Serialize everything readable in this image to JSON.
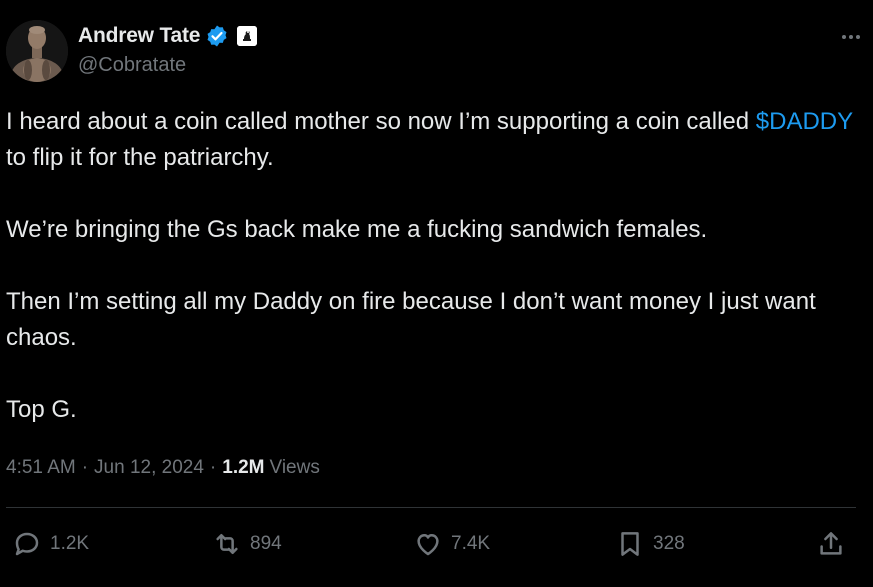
{
  "author": {
    "display_name": "Andrew Tate",
    "handle": "@Cobratate",
    "verified": true,
    "verified_color": "#1d9bf0"
  },
  "tweet": {
    "paragraphs": [
      {
        "pre": "I heard about a coin called mother so now I’m supporting a coin called",
        "cashtag": "$DADDY",
        "post": "to flip it for the patriarchy."
      },
      {
        "text": "We’re bringing the Gs back make me a fucking sandwich females."
      },
      {
        "text": "Then I’m setting all my Daddy on fire because I don’t want money I just want chaos."
      },
      {
        "text": "Top G."
      }
    ]
  },
  "meta": {
    "time": "4:51 AM",
    "separator": "·",
    "date": "Jun 12, 2024",
    "views_count": "1.2M",
    "views_label": "Views"
  },
  "actions": {
    "replies": "1.2K",
    "reposts": "894",
    "likes": "7.4K",
    "bookmarks": "328"
  },
  "colors": {
    "background": "#000000",
    "text": "#e7e9ea",
    "muted": "#71767b",
    "link": "#1d9bf0",
    "divider": "#2f3336"
  }
}
